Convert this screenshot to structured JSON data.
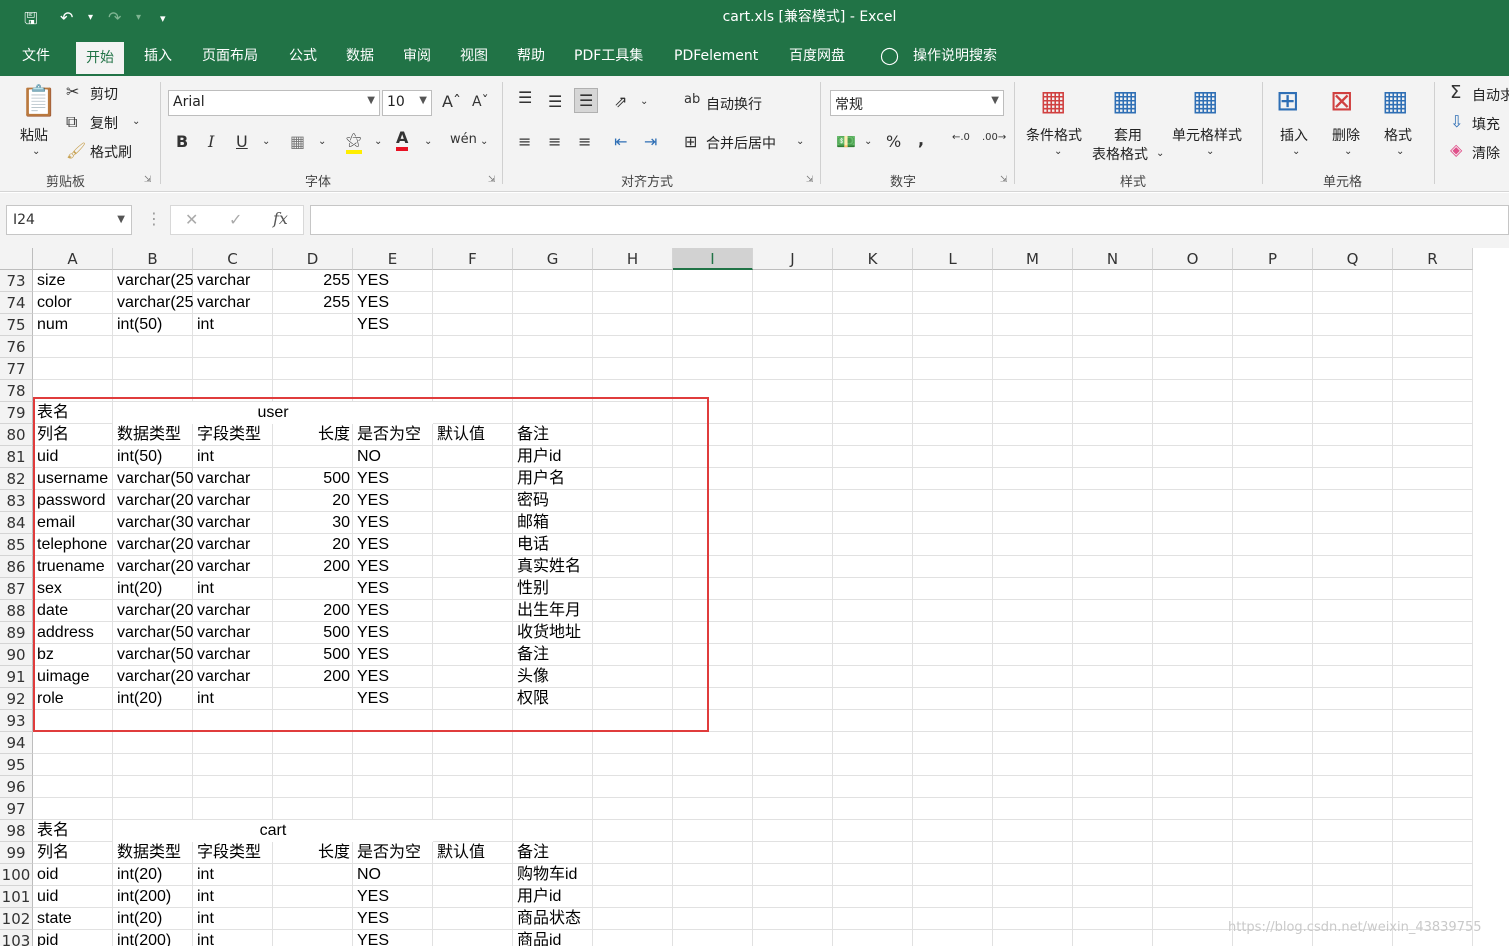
{
  "window": {
    "title": "cart.xls  [兼容模式]  -  Excel"
  },
  "menu": [
    "文件",
    "开始",
    "插入",
    "页面布局",
    "公式",
    "数据",
    "审阅",
    "视图",
    "帮助",
    "PDF工具集",
    "PDFelement",
    "百度网盘",
    "操作说明搜索"
  ],
  "ribbon": {
    "clipboard": {
      "paste": "粘贴",
      "cut": "剪切",
      "copy": "复制",
      "format_painter": "格式刷",
      "label": "剪贴板"
    },
    "font": {
      "name": "Arial",
      "size": "10",
      "label": "字体"
    },
    "alignment": {
      "wrap": "自动换行",
      "merge": "合并后居中",
      "label": "对齐方式"
    },
    "number": {
      "format": "常规",
      "label": "数字"
    },
    "styles": {
      "conditional": "条件格式",
      "table_a": "套用",
      "table_b": "表格格式",
      "cell_styles": "单元格样式",
      "label": "样式"
    },
    "cells": {
      "insert": "插入",
      "delete": "删除",
      "format": "格式",
      "label": "单元格"
    },
    "editing": {
      "autosum": "自动求",
      "fill": "填充",
      "clear": "清除"
    }
  },
  "formula_bar": {
    "name_box": "I24",
    "fx": "fx"
  },
  "columns": [
    "A",
    "B",
    "C",
    "D",
    "E",
    "F",
    "G",
    "H",
    "I",
    "J",
    "K",
    "L",
    "M",
    "N",
    "O",
    "P",
    "Q",
    "R"
  ],
  "selected_column": "I",
  "rows": [
    {
      "n": "73",
      "cells": [
        "size",
        "varchar(25",
        "varchar",
        "255",
        "YES",
        "",
        ""
      ]
    },
    {
      "n": "74",
      "cells": [
        "color",
        "varchar(25",
        "varchar",
        "255",
        "YES",
        "",
        ""
      ]
    },
    {
      "n": "75",
      "cells": [
        "num",
        "int(50)",
        "int",
        "",
        "YES",
        "",
        ""
      ]
    },
    {
      "n": "76",
      "cells": [
        "",
        "",
        "",
        "",
        "",
        "",
        ""
      ]
    },
    {
      "n": "77",
      "cells": [
        "",
        "",
        "",
        "",
        "",
        "",
        ""
      ]
    },
    {
      "n": "78",
      "cells": [
        "",
        "",
        "",
        "",
        "",
        "",
        ""
      ]
    },
    {
      "n": "79",
      "cells": [
        "表名",
        "",
        "",
        "",
        "",
        "",
        ""
      ],
      "merged": "user"
    },
    {
      "n": "80",
      "cells": [
        "列名",
        "数据类型",
        "字段类型",
        "长度",
        "是否为空",
        "默认值",
        "备注"
      ]
    },
    {
      "n": "81",
      "cells": [
        "uid",
        "int(50)",
        "int",
        "",
        "NO",
        "",
        "用户id"
      ]
    },
    {
      "n": "82",
      "cells": [
        "username",
        "varchar(50",
        "varchar",
        "500",
        "YES",
        "",
        "用户名"
      ]
    },
    {
      "n": "83",
      "cells": [
        "password",
        "varchar(20",
        "varchar",
        "20",
        "YES",
        "",
        "密码"
      ]
    },
    {
      "n": "84",
      "cells": [
        "email",
        "varchar(30",
        "varchar",
        "30",
        "YES",
        "",
        "邮箱"
      ]
    },
    {
      "n": "85",
      "cells": [
        "telephone",
        "varchar(20",
        "varchar",
        "20",
        "YES",
        "",
        "电话"
      ]
    },
    {
      "n": "86",
      "cells": [
        "truename",
        "varchar(20",
        "varchar",
        "200",
        "YES",
        "",
        "真实姓名"
      ]
    },
    {
      "n": "87",
      "cells": [
        "sex",
        "int(20)",
        "int",
        "",
        "YES",
        "",
        "性别"
      ]
    },
    {
      "n": "88",
      "cells": [
        "date",
        "varchar(20",
        "varchar",
        "200",
        "YES",
        "",
        "出生年月"
      ]
    },
    {
      "n": "89",
      "cells": [
        "address",
        "varchar(50",
        "varchar",
        "500",
        "YES",
        "",
        "收货地址"
      ]
    },
    {
      "n": "90",
      "cells": [
        "bz",
        "varchar(50",
        "varchar",
        "500",
        "YES",
        "",
        "备注"
      ]
    },
    {
      "n": "91",
      "cells": [
        "uimage",
        "varchar(20",
        "varchar",
        "200",
        "YES",
        "",
        "头像"
      ]
    },
    {
      "n": "92",
      "cells": [
        "role",
        "int(20)",
        "int",
        "",
        "YES",
        "",
        "权限"
      ]
    },
    {
      "n": "93",
      "cells": [
        "",
        "",
        "",
        "",
        "",
        "",
        ""
      ]
    },
    {
      "n": "94",
      "cells": [
        "",
        "",
        "",
        "",
        "",
        "",
        ""
      ]
    },
    {
      "n": "95",
      "cells": [
        "",
        "",
        "",
        "",
        "",
        "",
        ""
      ]
    },
    {
      "n": "96",
      "cells": [
        "",
        "",
        "",
        "",
        "",
        "",
        ""
      ]
    },
    {
      "n": "97",
      "cells": [
        "",
        "",
        "",
        "",
        "",
        "",
        ""
      ]
    },
    {
      "n": "98",
      "cells": [
        "表名",
        "",
        "",
        "",
        "",
        "",
        ""
      ],
      "merged": "cart"
    },
    {
      "n": "99",
      "cells": [
        "列名",
        "数据类型",
        "字段类型",
        "长度",
        "是否为空",
        "默认值",
        "备注"
      ]
    },
    {
      "n": "100",
      "cells": [
        "oid",
        "int(20)",
        "int",
        "",
        "NO",
        "",
        "购物车id"
      ]
    },
    {
      "n": "101",
      "cells": [
        "uid",
        "int(200)",
        "int",
        "",
        "YES",
        "",
        "用户id"
      ]
    },
    {
      "n": "102",
      "cells": [
        "state",
        "int(20)",
        "int",
        "",
        "YES",
        "",
        "商品状态"
      ]
    },
    {
      "n": "103",
      "cells": [
        "pid",
        "int(200)",
        "int",
        "",
        "YES",
        "",
        "商品id"
      ]
    }
  ],
  "watermark": "https://blog.csdn.net/weixin_43839755"
}
